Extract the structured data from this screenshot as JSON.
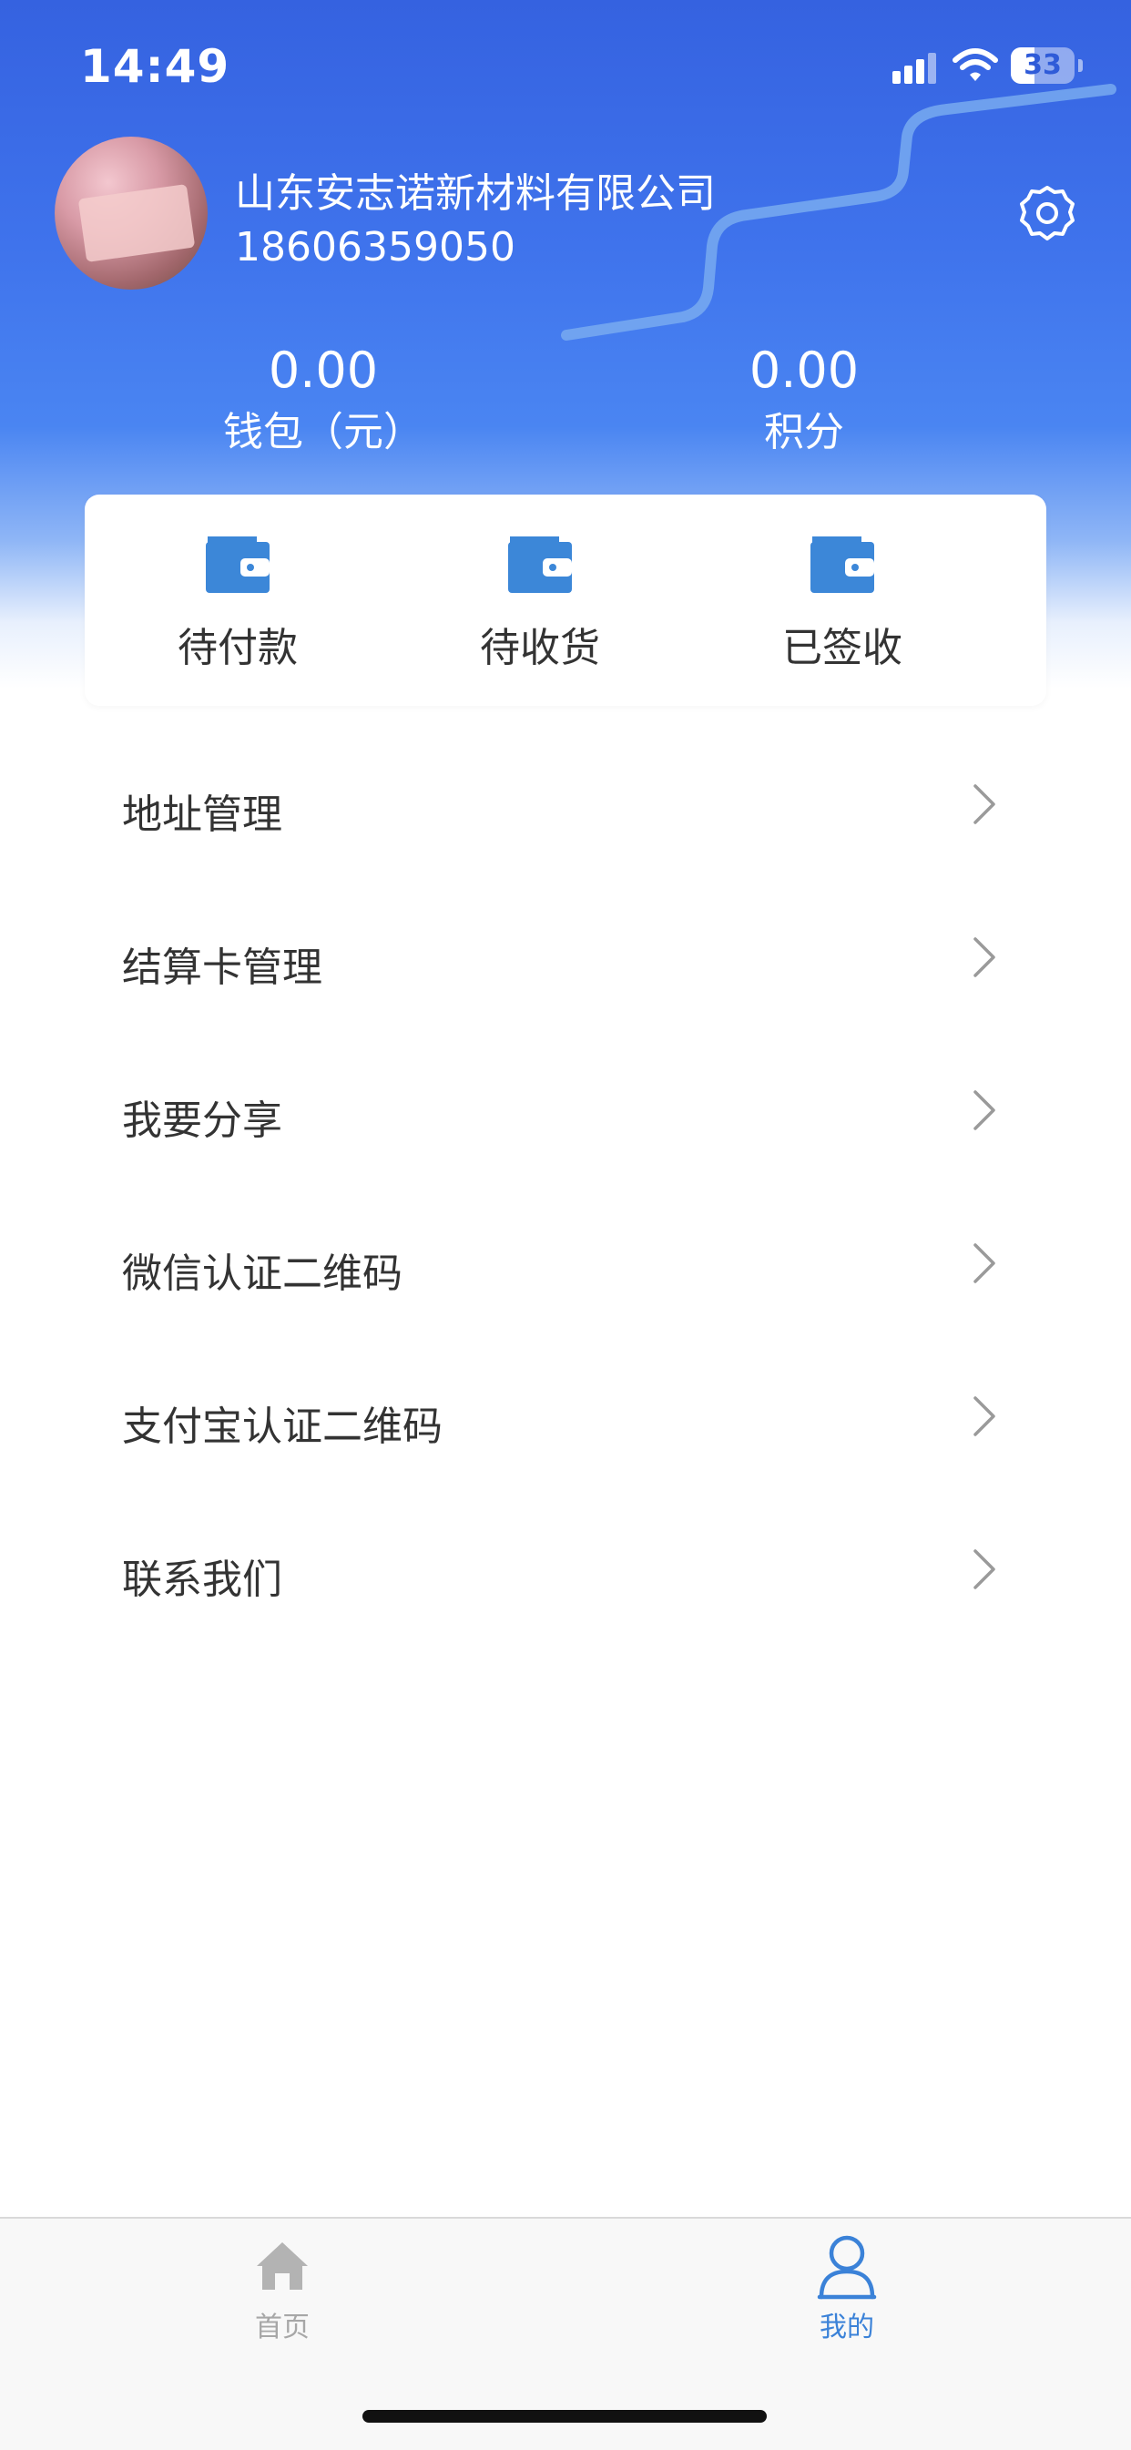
{
  "status_bar": {
    "time": "14:49",
    "battery": "33"
  },
  "profile": {
    "company_name": "山东安志诺新材料有限公司",
    "phone": "18606359050",
    "avatar_icon": "avatar-photo",
    "settings_icon": "gear-icon"
  },
  "stats": {
    "wallet": {
      "value": "0.00",
      "label": "钱包（元）"
    },
    "points": {
      "value": "0.00",
      "label": "积分"
    }
  },
  "orders": [
    {
      "label": "待付款",
      "icon": "wallet-icon"
    },
    {
      "label": "待收货",
      "icon": "wallet-icon"
    },
    {
      "label": "已签收",
      "icon": "wallet-icon"
    }
  ],
  "menu": [
    {
      "label": "地址管理"
    },
    {
      "label": "结算卡管理"
    },
    {
      "label": "我要分享"
    },
    {
      "label": "微信认证二维码"
    },
    {
      "label": "支付宝认证二维码"
    },
    {
      "label": "联系我们"
    }
  ],
  "tab_bar": {
    "home": {
      "label": "首页",
      "icon": "home-icon",
      "active": false
    },
    "mine": {
      "label": "我的",
      "icon": "person-icon",
      "active": true
    }
  },
  "colors": {
    "header_top": "#3562e0",
    "accent": "#3b82d8",
    "order_icon": "#3c87d8",
    "text": "#333333"
  }
}
